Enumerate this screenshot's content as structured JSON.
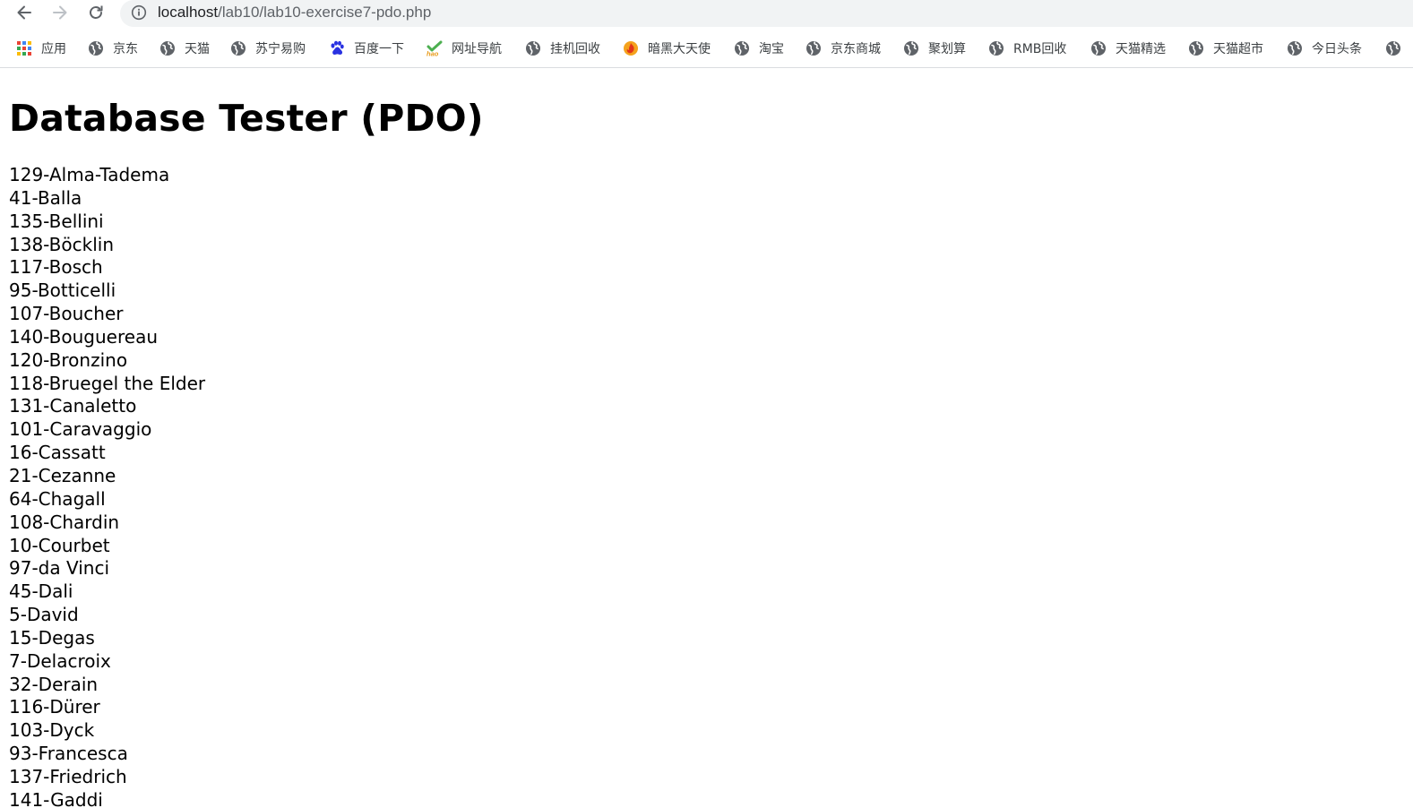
{
  "browser": {
    "url_host": "localhost",
    "url_path": "/lab10/lab10-exercise7-pdo.php",
    "bookmarks": [
      {
        "label": "应用",
        "icon": "apps-grid-icon"
      },
      {
        "label": "京东",
        "icon": "globe-icon"
      },
      {
        "label": "天猫",
        "icon": "globe-icon"
      },
      {
        "label": "苏宁易购",
        "icon": "globe-icon"
      },
      {
        "label": "百度一下",
        "icon": "baidu-paw-icon"
      },
      {
        "label": "网址导航",
        "icon": "hao-icon"
      },
      {
        "label": "挂机回收",
        "icon": "globe-icon"
      },
      {
        "label": "暗黑大天使",
        "icon": "game-flame-icon"
      },
      {
        "label": "淘宝",
        "icon": "globe-icon"
      },
      {
        "label": "京东商城",
        "icon": "globe-icon"
      },
      {
        "label": "聚划算",
        "icon": "globe-icon"
      },
      {
        "label": "RMB回收",
        "icon": "globe-icon"
      },
      {
        "label": "天猫精选",
        "icon": "globe-icon"
      },
      {
        "label": "天猫超市",
        "icon": "globe-icon"
      },
      {
        "label": "今日头条",
        "icon": "globe-icon"
      },
      {
        "label": "",
        "icon": "globe-icon"
      }
    ]
  },
  "page": {
    "title": "Database Tester (PDO)",
    "artists": [
      "129-Alma-Tadema",
      "41-Balla",
      "135-Bellini",
      "138-Böcklin",
      "117-Bosch",
      "95-Botticelli",
      "107-Boucher",
      "140-Bouguereau",
      "120-Bronzino",
      "118-Bruegel the Elder",
      "131-Canaletto",
      "101-Caravaggio",
      "16-Cassatt",
      "21-Cezanne",
      "64-Chagall",
      "108-Chardin",
      "10-Courbet",
      "97-da Vinci",
      "45-Dali",
      "5-David",
      "15-Degas",
      "7-Delacroix",
      "32-Derain",
      "116-Dürer",
      "103-Dyck",
      "93-Francesca",
      "137-Friedrich",
      "141-Gaddi"
    ]
  }
}
